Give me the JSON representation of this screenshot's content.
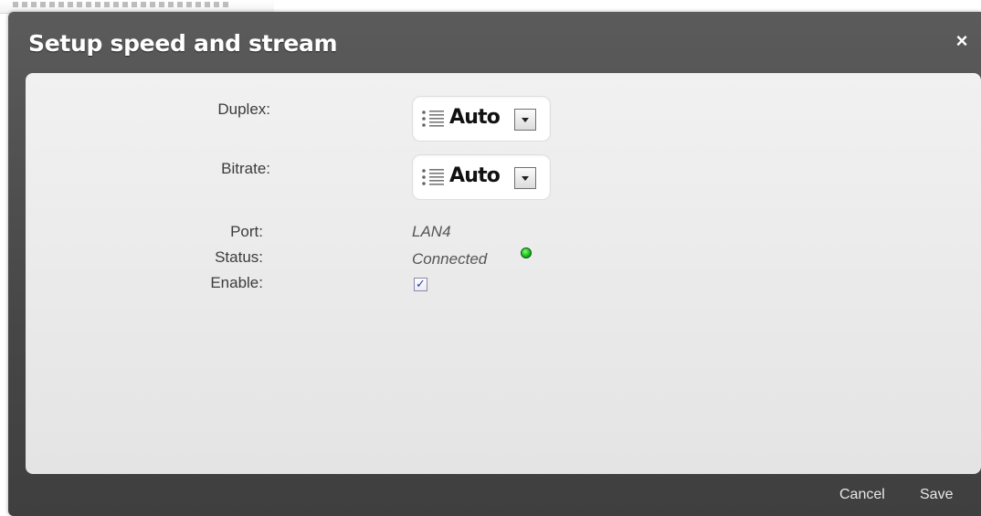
{
  "dialog": {
    "title": "Setup speed and stream",
    "close_symbol": "×"
  },
  "fields": {
    "duplex": {
      "label": "Duplex:",
      "value": "Auto"
    },
    "bitrate": {
      "label": "Bitrate:",
      "value": "Auto"
    },
    "port": {
      "label": "Port:",
      "value": "LAN4"
    },
    "status": {
      "label": "Status:",
      "value": "Connected",
      "indicator_color": "#17b41c"
    },
    "enable": {
      "label": "Enable:",
      "checked": true
    }
  },
  "footer": {
    "cancel_label": "Cancel",
    "save_label": "Save"
  },
  "icons": {
    "close": "close-icon",
    "select_list": "list-icon",
    "dropdown": "chevron-down-icon",
    "status": "status-indicator-icon",
    "check": "checkmark-icon"
  },
  "colors": {
    "dialog_bg": "#4a4a4a",
    "panel_bg": "#ececec",
    "title_text": "#ffffff",
    "status_ok": "#17b41c"
  }
}
